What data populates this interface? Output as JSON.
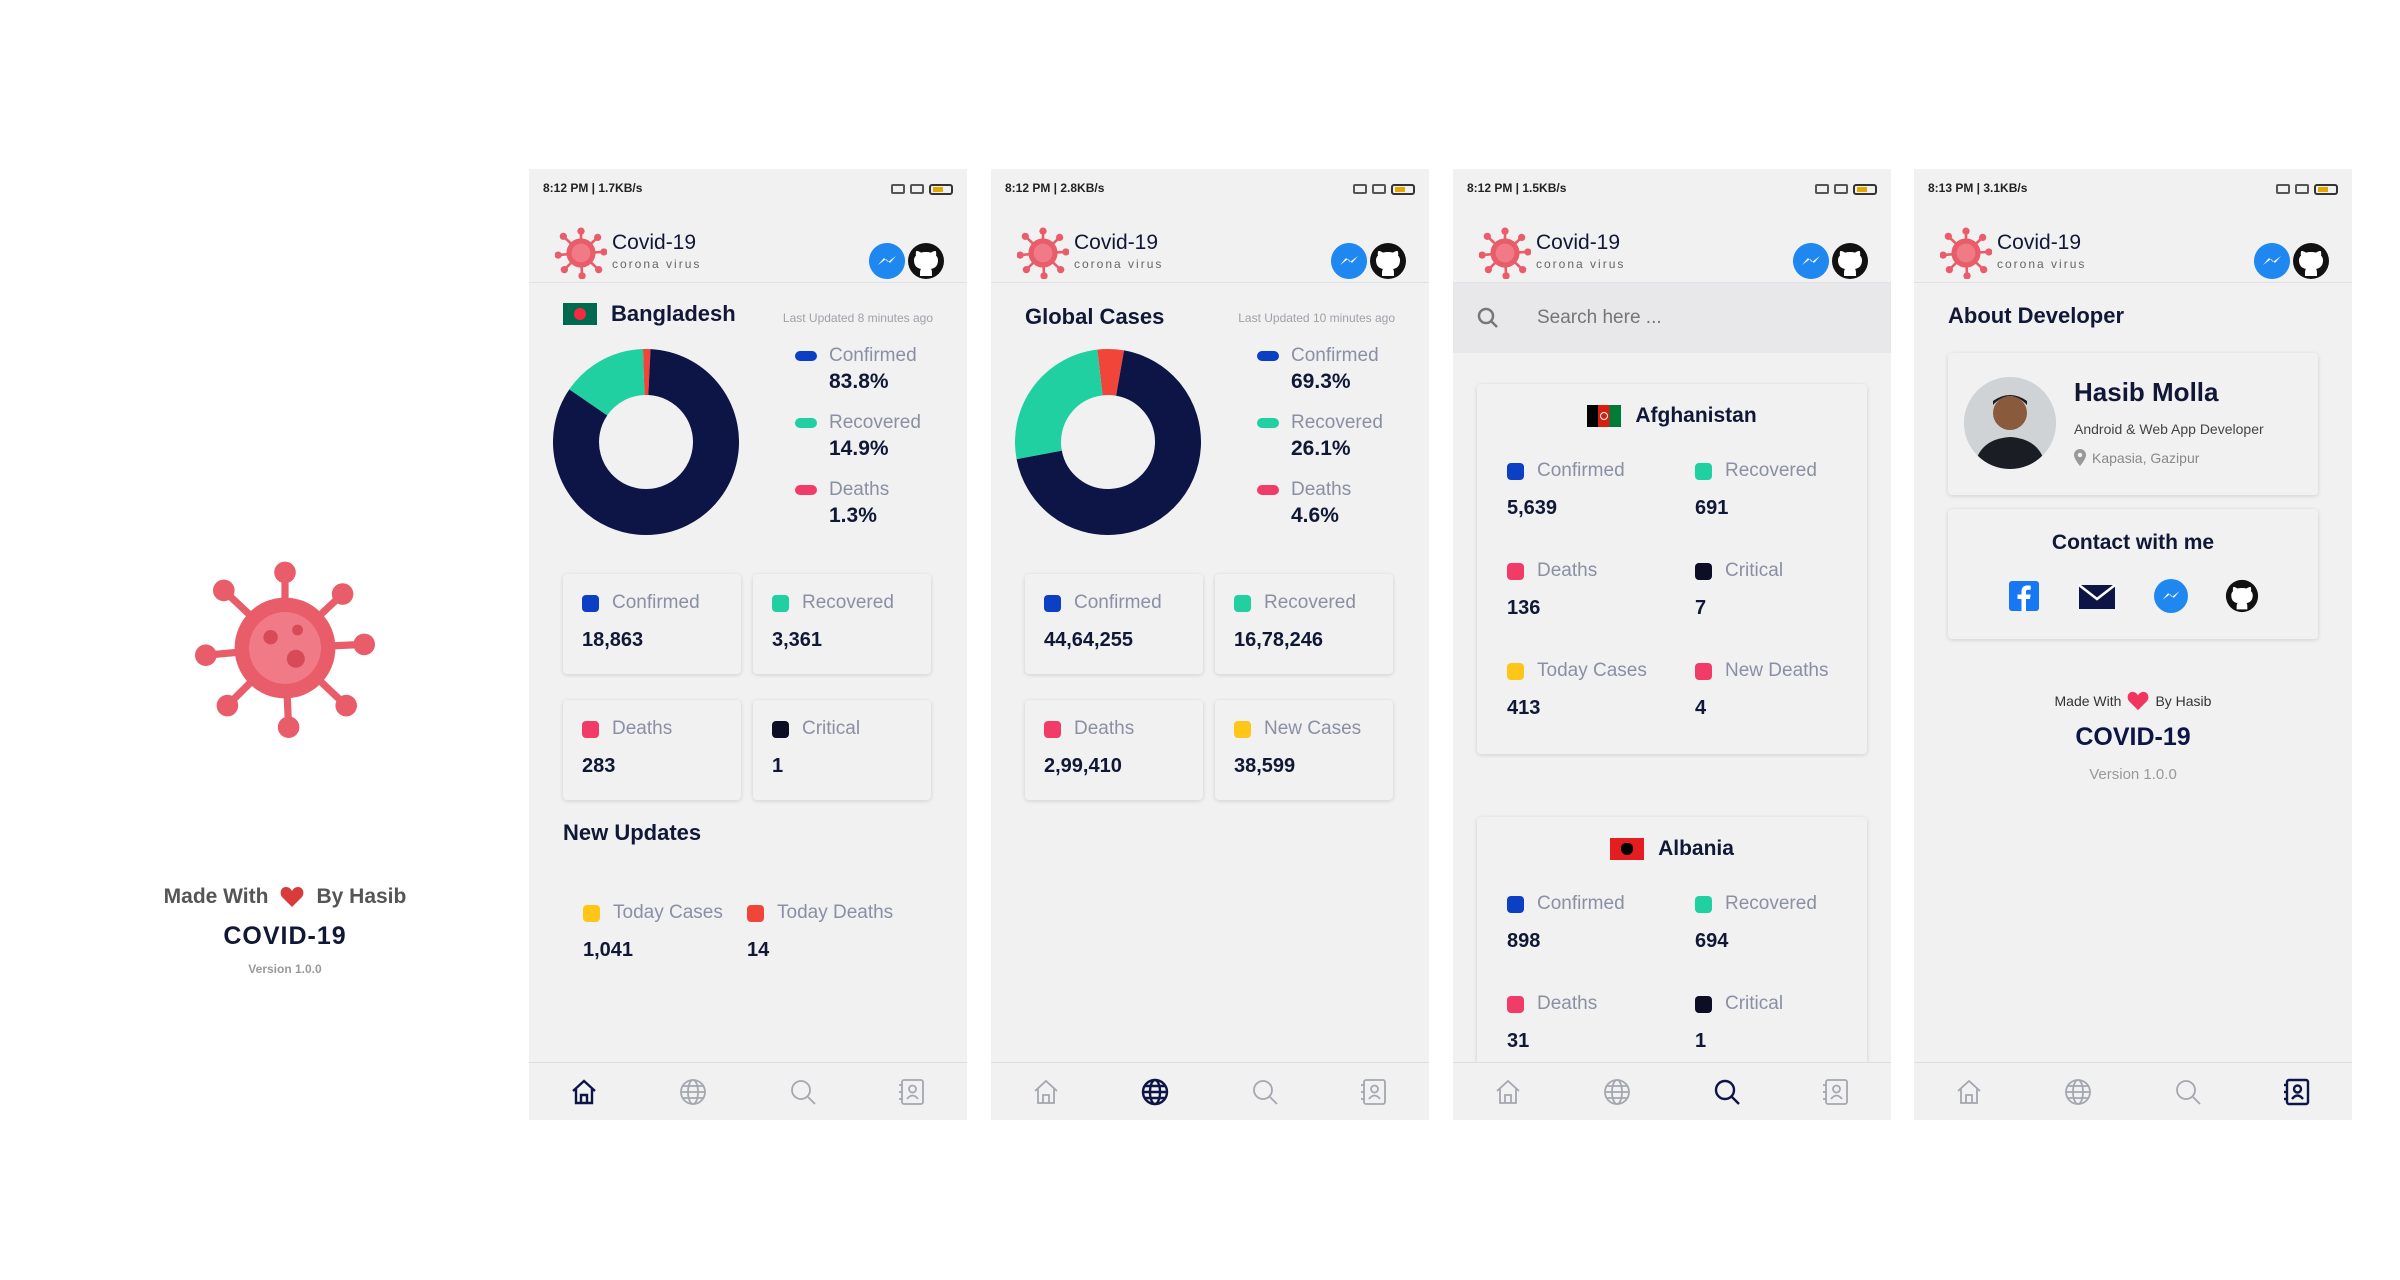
{
  "splash": {
    "made_with": "Made With",
    "by": "By Hasib",
    "title": "COVID-19",
    "version": "Version 1.0.0"
  },
  "app": {
    "title": "Covid-19",
    "subtitle": "corona virus"
  },
  "colors": {
    "navy": "#0d1546",
    "blue": "#0b3fc4",
    "green": "#20d0a0",
    "red": "#f23c68",
    "dark": "#0d0d26",
    "yellow": "#ffc61a",
    "orange_red": "#f2453a",
    "virus": "#e95c69"
  },
  "phone1": {
    "status_time": "8:12 PM | 1.7KB/s",
    "country": "Bangladesh",
    "updated": "Last Updated 8 minutes ago",
    "legend": [
      {
        "label": "Confirmed",
        "value": "83.8%",
        "color": "#0b3fc4"
      },
      {
        "label": "Recovered",
        "value": "14.9%",
        "color": "#20d0a0"
      },
      {
        "label": "Deaths",
        "value": "1.3%",
        "color": "#f23c68"
      }
    ],
    "stats": [
      {
        "label": "Confirmed",
        "value": "18,863",
        "color": "#0b3fc4"
      },
      {
        "label": "Recovered",
        "value": "3,361",
        "color": "#20d0a0"
      },
      {
        "label": "Deaths",
        "value": "283",
        "color": "#f23c68"
      },
      {
        "label": "Critical",
        "value": "1",
        "color": "#0d0d26"
      }
    ],
    "new_updates_title": "New Updates",
    "updates": [
      {
        "label": "Today Cases",
        "value": "1,041",
        "color": "#ffc61a"
      },
      {
        "label": "Today Deaths",
        "value": "14",
        "color": "#f2453a"
      }
    ]
  },
  "phone2": {
    "status_time": "8:12 PM | 2.8KB/s",
    "title": "Global Cases",
    "updated": "Last Updated 10 minutes ago",
    "legend": [
      {
        "label": "Confirmed",
        "value": "69.3%",
        "color": "#0b3fc4"
      },
      {
        "label": "Recovered",
        "value": "26.1%",
        "color": "#20d0a0"
      },
      {
        "label": "Deaths",
        "value": "4.6%",
        "color": "#f23c68"
      }
    ],
    "stats": [
      {
        "label": "Confirmed",
        "value": "44,64,255",
        "color": "#0b3fc4"
      },
      {
        "label": "Recovered",
        "value": "16,78,246",
        "color": "#20d0a0"
      },
      {
        "label": "Deaths",
        "value": "2,99,410",
        "color": "#f23c68"
      },
      {
        "label": "New Cases",
        "value": "38,599",
        "color": "#ffc61a"
      }
    ]
  },
  "phone3": {
    "status_time": "8:12 PM | 1.5KB/s",
    "search_placeholder": "Search here ...",
    "countries": [
      {
        "name": "Afghanistan",
        "stats": [
          {
            "label": "Confirmed",
            "value": "5,639",
            "color": "#0b3fc4"
          },
          {
            "label": "Recovered",
            "value": "691",
            "color": "#20d0a0"
          },
          {
            "label": "Deaths",
            "value": "136",
            "color": "#f23c68"
          },
          {
            "label": "Critical",
            "value": "7",
            "color": "#0d0d26"
          },
          {
            "label": "Today Cases",
            "value": "413",
            "color": "#ffc61a"
          },
          {
            "label": "New Deaths",
            "value": "4",
            "color": "#f23c68"
          }
        ]
      },
      {
        "name": "Albania",
        "stats": [
          {
            "label": "Confirmed",
            "value": "898",
            "color": "#0b3fc4"
          },
          {
            "label": "Recovered",
            "value": "694",
            "color": "#20d0a0"
          },
          {
            "label": "Deaths",
            "value": "31",
            "color": "#f23c68"
          },
          {
            "label": "Critical",
            "value": "1",
            "color": "#0d0d26"
          }
        ]
      }
    ]
  },
  "phone4": {
    "status_time": "8:13 PM | 3.1KB/s",
    "title": "About Developer",
    "dev_name": "Hasib Molla",
    "dev_role": "Android & Web App Developer",
    "dev_location": "Kapasia, Gazipur",
    "contact_title": "Contact with me",
    "contact_icons": [
      "facebook-icon",
      "mail-icon",
      "messenger-icon",
      "github-icon"
    ],
    "made_with": "Made With",
    "by": "By Hasib",
    "footer_title": "COVID-19",
    "version": "Version 1.0.0"
  },
  "nav_icons": [
    "home-icon",
    "globe-icon",
    "search-icon",
    "contact-book-icon"
  ]
}
